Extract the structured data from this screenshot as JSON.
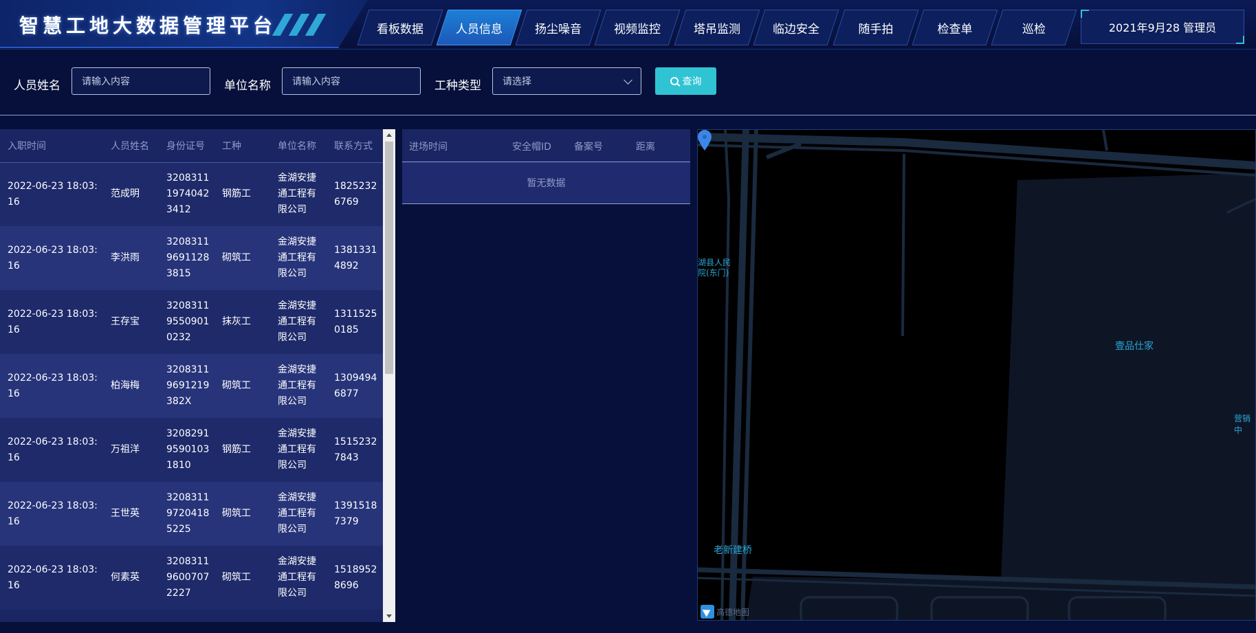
{
  "header": {
    "title": "智慧工地大数据管理平台",
    "nav": [
      {
        "label": "看板数据",
        "active": false
      },
      {
        "label": "人员信息",
        "active": true
      },
      {
        "label": "扬尘噪音",
        "active": false
      },
      {
        "label": "视频监控",
        "active": false
      },
      {
        "label": "塔吊监测",
        "active": false
      },
      {
        "label": "临边安全",
        "active": false
      },
      {
        "label": "随手拍",
        "active": false
      },
      {
        "label": "检查单",
        "active": false
      },
      {
        "label": "巡检",
        "active": false
      }
    ],
    "date_user": "2021年9月28 管理员"
  },
  "filter": {
    "name_label": "人员姓名",
    "name_placeholder": "请输入内容",
    "unit_label": "单位名称",
    "unit_placeholder": "请输入内容",
    "type_label": "工种类型",
    "type_placeholder": "请选择",
    "search_label": "查询"
  },
  "personnel_table": {
    "columns": [
      "入职时间",
      "人员姓名",
      "身份证号",
      "工种",
      "单位名称",
      "联系方式"
    ],
    "rows": [
      [
        "2022-06-23 18:03:16",
        "范成明",
        "320831119740423412",
        "钢筋工",
        "金湖安捷通工程有限公司",
        "18252326769"
      ],
      [
        "2022-06-23 18:03:16",
        "李洪雨",
        "320831196911283815",
        "砌筑工",
        "金湖安捷通工程有限公司",
        "13813314892"
      ],
      [
        "2022-06-23 18:03:16",
        "王存宝",
        "320831195509010232",
        "抹灰工",
        "金湖安捷通工程有限公司",
        "13115250185"
      ],
      [
        "2022-06-23 18:03:16",
        "柏海梅",
        "32083119691219382X",
        "砌筑工",
        "金湖安捷通工程有限公司",
        "13094946877"
      ],
      [
        "2022-06-23 18:03:16",
        "万祖洋",
        "320829195901031810",
        "钢筋工",
        "金湖安捷通工程有限公司",
        "15152327843"
      ],
      [
        "2022-06-23 18:03:16",
        "王世英",
        "320831197204185225",
        "砌筑工",
        "金湖安捷通工程有限公司",
        "13915187379"
      ],
      [
        "2022-06-23 18:03:16",
        "何素英",
        "320831196007072227",
        "砌筑工",
        "金湖安捷通工程有限公司",
        "15189528696"
      ]
    ]
  },
  "entry_table": {
    "columns": [
      "进场时间",
      "安全帽ID",
      "备案号",
      "距离"
    ],
    "empty_text": "暂无数据"
  },
  "map": {
    "labels": {
      "hospital": "湖县人民\n院(东门)",
      "residence": "壹品仕家",
      "sales": "营销中",
      "bridge": "老新建桥"
    },
    "logo_text": "高德地图",
    "pin_color": "#3b86e8"
  }
}
